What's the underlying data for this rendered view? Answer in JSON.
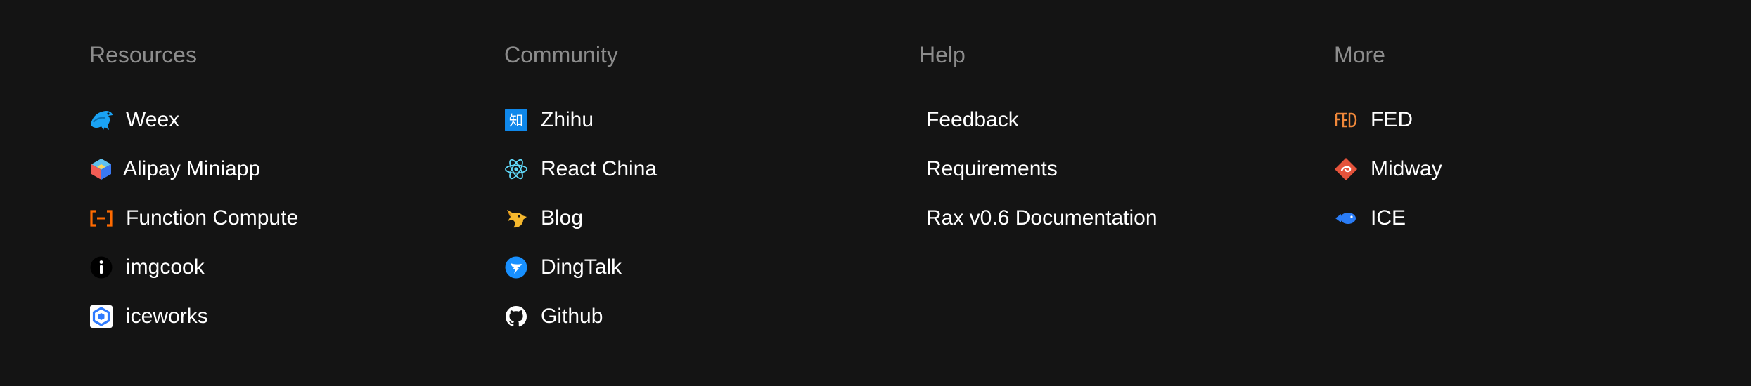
{
  "columns": [
    {
      "title": "Resources",
      "links": [
        {
          "label": "Weex",
          "icon": "weex-bird-icon"
        },
        {
          "label": "Alipay Miniapp",
          "icon": "alipay-miniapp-cube-icon"
        },
        {
          "label": "Function Compute",
          "icon": "function-compute-bracket-icon"
        },
        {
          "label": "imgcook",
          "icon": "imgcook-info-icon"
        },
        {
          "label": "iceworks",
          "icon": "iceworks-hexagon-icon"
        }
      ]
    },
    {
      "title": "Community",
      "links": [
        {
          "label": "Zhihu",
          "icon": "zhihu-icon",
          "icon_text": "知"
        },
        {
          "label": "React China",
          "icon": "react-atom-icon"
        },
        {
          "label": "Blog",
          "icon": "blog-fox-icon"
        },
        {
          "label": "DingTalk",
          "icon": "dingtalk-icon"
        },
        {
          "label": "Github",
          "icon": "github-icon"
        }
      ]
    },
    {
      "title": "Help",
      "links": [
        {
          "label": "Feedback"
        },
        {
          "label": "Requirements"
        },
        {
          "label": "Rax v0.6 Documentation"
        }
      ]
    },
    {
      "title": "More",
      "links": [
        {
          "label": "FED",
          "icon": "fed-logo-icon"
        },
        {
          "label": "Midway",
          "icon": "midway-diamond-icon"
        },
        {
          "label": "ICE",
          "icon": "ice-fish-icon"
        }
      ]
    }
  ],
  "colors": {
    "background": "#141414",
    "title": "#8c8c8c",
    "link": "#ffffff",
    "weex": "#1aa3f5",
    "function_compute": "#ff6a00",
    "zhihu": "#0f88eb",
    "react": "#61dafb",
    "blog": "#f5b82e",
    "dingtalk": "#1890ff",
    "fed": "#f0883a",
    "midway": "#e5533b",
    "ice": "#2a7cf6"
  }
}
